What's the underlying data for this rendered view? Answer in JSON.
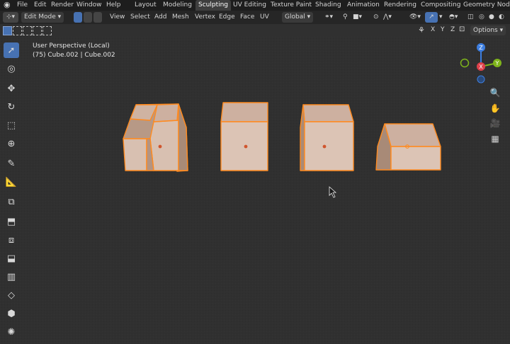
{
  "menu": {
    "items": [
      "File",
      "Edit",
      "Render",
      "Window",
      "Help"
    ]
  },
  "workspaces": {
    "tabs": [
      "Layout",
      "Modeling",
      "Sculpting",
      "UV Editing",
      "Texture Paint",
      "Shading",
      "Animation",
      "Rendering",
      "Compositing",
      "Geometry Nodes"
    ],
    "active": "Sculpting"
  },
  "header": {
    "mode": "Edit Mode",
    "menus": [
      "View",
      "Select",
      "Add",
      "Mesh",
      "Vertex",
      "Edge",
      "Face",
      "UV"
    ],
    "transform_orientation": "Global"
  },
  "subheader": {
    "axes": [
      "X",
      "Y",
      "Z"
    ],
    "options_label": "Options"
  },
  "viewport": {
    "perspective_label": "User Perspective (Local)",
    "object_label": "(75) Cube.002 | Cube.002"
  },
  "gizmo": {
    "axis_x": "X",
    "axis_y": "Y",
    "axis_z": "Z",
    "colors": {
      "x": "#e0414b",
      "y": "#7fb51b",
      "z": "#3d7ee0"
    }
  },
  "colors": {
    "accent": "#4772b3",
    "selected_edge": "#ff8a1f",
    "face_fill": "#c9aa98"
  },
  "toolbar": {
    "tools": [
      "select-box",
      "cursor",
      "move",
      "rotate",
      "scale",
      "transform",
      "annotate",
      "measure",
      "add-cube",
      "extrude",
      "inset",
      "bevel",
      "loop-cut",
      "knife",
      "poly-build",
      "spin"
    ]
  }
}
